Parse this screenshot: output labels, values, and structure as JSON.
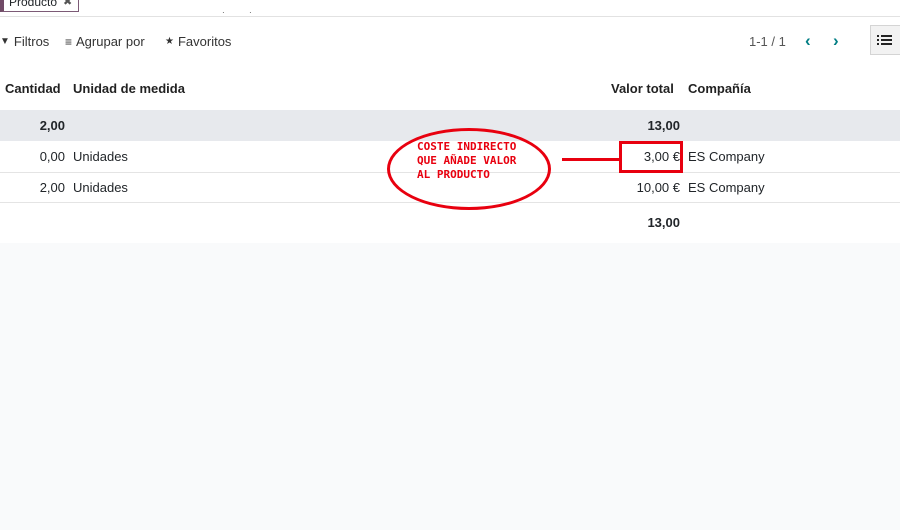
{
  "search": {
    "facet_label": "Producto",
    "facet_remove_icon": "close-icon"
  },
  "control_panel": {
    "filters_label": "Filtros",
    "group_by_label": "Agrupar por",
    "favorites_label": "Favoritos",
    "pager_value": "1-1 / 1",
    "prev_icon": "chevron-left-icon",
    "next_icon": "chevron-right-icon",
    "view_icon": "list-view-icon"
  },
  "table": {
    "columns": [
      "Cantidad",
      "Unidad de medida",
      "Valor total",
      "Compañía"
    ],
    "group": {
      "quantity": "2,00",
      "total": "13,00"
    },
    "rows": [
      {
        "quantity": "0,00",
        "uom": "Unidades",
        "total": "3,00 €",
        "company": "ES Company"
      },
      {
        "quantity": "2,00",
        "uom": "Unidades",
        "total": "10,00 €",
        "company": "ES Company"
      }
    ],
    "footer_total": "13,00"
  },
  "annotation": {
    "text": "COSTE INDIRECTO\nQUE AÑADE VALOR\nAL PRODUCTO",
    "color": "#e8000f"
  },
  "colors": {
    "brand": "#714B67",
    "accent": "#017e84",
    "group_row": "#e7e9ed"
  }
}
